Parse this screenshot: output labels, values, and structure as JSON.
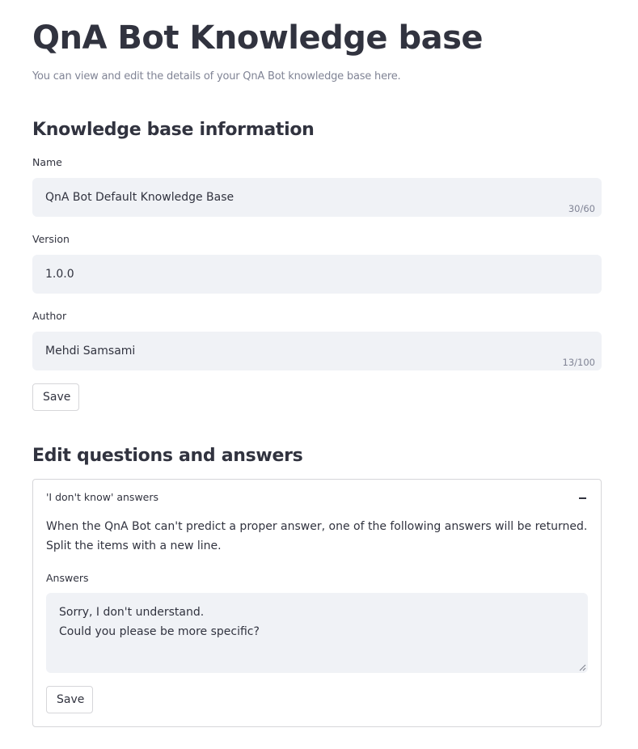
{
  "header": {
    "title": "QnA Bot Knowledge base",
    "subtitle": "You can view and edit the details of your QnA Bot knowledge base here."
  },
  "kb_info": {
    "heading": "Knowledge base information",
    "name": {
      "label": "Name",
      "value": "QnA Bot Default Knowledge Base",
      "counter": "30/60"
    },
    "version": {
      "label": "Version",
      "value": "1.0.0"
    },
    "author": {
      "label": "Author",
      "value": "Mehdi Samsami",
      "counter": "13/100"
    },
    "save_label": "Save"
  },
  "qa": {
    "heading": "Edit questions and answers",
    "expander": {
      "title": "'I don't know' answers",
      "toggle_icon": "minus-icon",
      "description": "When the QnA Bot can't predict a proper answer, one of the following answers will be returned. Split the items with a new line.",
      "answers_label": "Answers",
      "answers_value": "Sorry, I don't understand.\nCould you please be more specific?",
      "save_label": "Save"
    }
  }
}
